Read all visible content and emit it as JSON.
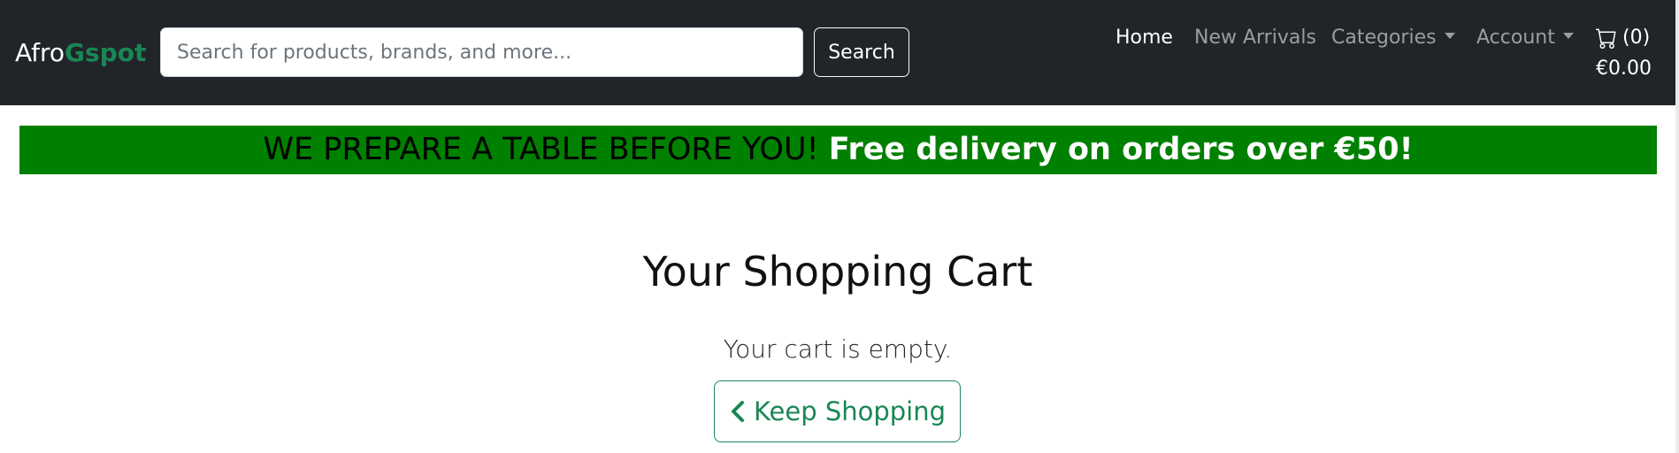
{
  "navbar": {
    "brand_main": "Afro",
    "brand_accent": "Gspot",
    "search_placeholder": "Search for products, brands, and more...",
    "search_button": "Search",
    "links": {
      "home": "Home",
      "new_arrivals": "New Arrivals",
      "categories": "Categories",
      "account": "Account"
    },
    "cart": {
      "icon": "cart-icon",
      "count": "(0)",
      "total": "€0.00"
    }
  },
  "promo": {
    "tagline": "WE PREPARE A TABLE BEFORE YOU!",
    "offer": "Free delivery on orders over €50!"
  },
  "main": {
    "title": "Your Shopping Cart",
    "empty_message": "Your cart is empty.",
    "keep_shopping_label": "Keep Shopping",
    "keep_shopping_icon": "chevron-left-icon"
  },
  "colors": {
    "navbar_bg": "#212529",
    "brand_accent": "#198754",
    "promo_bg": "#008000",
    "button_accent": "#198754"
  }
}
